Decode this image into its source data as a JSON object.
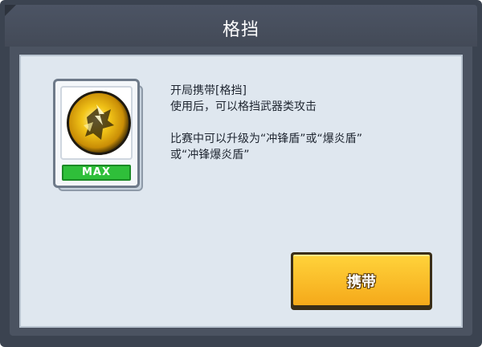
{
  "dialog": {
    "title": "格挡"
  },
  "item": {
    "badge": "MAX",
    "icon": "shield-block-icon"
  },
  "description": {
    "line1": "开局携带[格挡]",
    "line2": "使用后，可以格挡武器类攻击",
    "line3": "比赛中可以升级为“冲锋盾”或“爆炎盾”",
    "line4": "或“冲锋爆炎盾”"
  },
  "actions": {
    "carry_label": "携带"
  },
  "colors": {
    "frame": "#3b4350",
    "panel": "#dfe7ef",
    "button": "#f5b520",
    "badge": "#2fbf3a"
  }
}
